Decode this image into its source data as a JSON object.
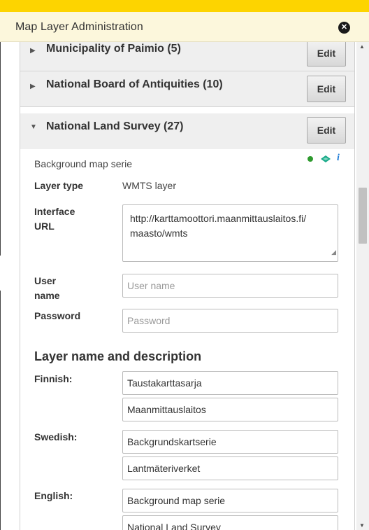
{
  "header": {
    "title": "Map Layer Administration",
    "close_icon": "close-icon"
  },
  "organizations": [
    {
      "name": "Municipality of Paimio (5)",
      "edit_label": "Edit",
      "expanded": false
    },
    {
      "name": "National Board of Antiquities (10)",
      "edit_label": "Edit",
      "expanded": false
    },
    {
      "name": "National Land Survey (27)",
      "edit_label": "Edit",
      "expanded": true
    }
  ],
  "layer": {
    "description": "Background map serie",
    "status_color": "#2e9a2e",
    "layer_type_label": "Layer type",
    "layer_type_value": "WMTS layer",
    "interface_url_label_1": "Interface",
    "interface_url_label_2": "URL",
    "interface_url_line_1": "http://karttamoottori.maanmittauslaitos.fi/",
    "interface_url_line_2": "maasto/wmts",
    "username_label_1": "User",
    "username_label_2": "name",
    "username_placeholder": "User name",
    "password_label": "Password",
    "password_placeholder": "Password"
  },
  "names": {
    "section_title": "Layer name and description",
    "finnish_label": "Finnish:",
    "finnish_name": "Taustakarttasarja",
    "finnish_desc": "Maanmittauslaitos",
    "swedish_label": "Swedish:",
    "swedish_name": "Backgrundskartserie",
    "swedish_desc": "Lantmäteriverket",
    "english_label": "English:",
    "english_name": "Background map serie",
    "english_desc": "National Land Survey"
  },
  "colors": {
    "top_bar": "#FDD400",
    "header_bg": "#FCF7DC",
    "info": "#1a7ad6",
    "layers_icon": "#1aaa8a"
  }
}
